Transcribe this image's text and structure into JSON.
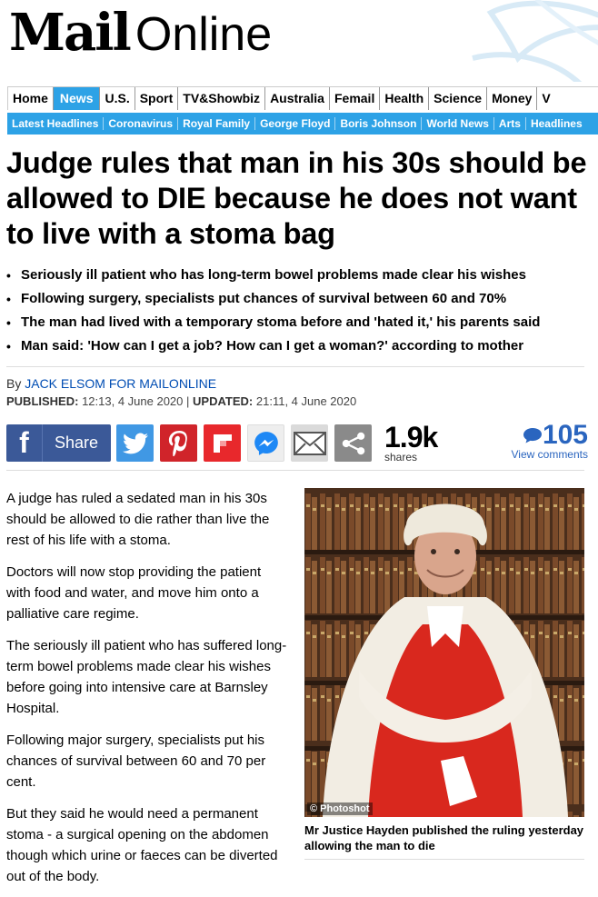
{
  "brand": {
    "mail": "Mail",
    "online": "Online"
  },
  "nav_primary": [
    "Home",
    "News",
    "U.S.",
    "Sport",
    "TV&Showbiz",
    "Australia",
    "Femail",
    "Health",
    "Science",
    "Money",
    "V"
  ],
  "nav_primary_active": "News",
  "nav_secondary": [
    "Latest Headlines",
    "Coronavirus",
    "Royal Family",
    "George Floyd",
    "Boris Johnson",
    "World News",
    "Arts",
    "Headlines"
  ],
  "article": {
    "headline": "Judge rules that man in his 30s should be allowed to DIE because he does not want to live with a stoma bag",
    "bullets": [
      "Seriously ill patient who has long-term bowel problems made clear his wishes",
      "Following surgery, specialists put chances of survival between 60 and 70%",
      "The man had lived with a temporary stoma before and 'hated it,' his parents said",
      "Man said: 'How can I get a job? How can I get a woman?' according to mother"
    ],
    "byline_prefix": "By",
    "author": "JACK ELSOM FOR MAILONLINE",
    "published_label": "PUBLISHED:",
    "published": "12:13, 4 June 2020",
    "separator": "|",
    "updated_label": "UPDATED:",
    "updated": "21:11, 4 June 2020",
    "paragraphs": [
      "A judge has ruled a sedated man in his 30s should be allowed to die rather than live the rest of his life with a stoma.",
      "Doctors will now stop providing the patient with food and water, and move him onto a palliative care regime.",
      "The seriously ill patient who has suffered long-term bowel problems made clear his wishes before going into intensive care at Barnsley Hospital.",
      "Following major surgery, specialists put his chances of survival between 60 and 70 per cent.",
      "But they said he would need a permanent stoma - a surgical opening on the abdomen though which urine or faeces can be diverted out of the body."
    ],
    "image_credit": "© Photoshot",
    "image_caption": "Mr Justice Hayden published the ruling yesterday allowing the man to die"
  },
  "share": {
    "facebook_label": "Share",
    "count": "1.9k",
    "count_label": "shares",
    "comments_count": "105",
    "comments_label": "View comments",
    "icons": [
      "facebook-icon",
      "twitter-icon",
      "pinterest-icon",
      "flipboard-icon",
      "messenger-icon",
      "email-icon",
      "share-more-icon"
    ]
  },
  "colors": {
    "nav_blue": "#2da2e6",
    "link_blue": "#004db3",
    "facebook": "#3b5998",
    "twitter": "#4098e4",
    "pinterest": "#d0242a",
    "flipboard": "#e8282c",
    "comments_blue": "#2a65bf"
  }
}
